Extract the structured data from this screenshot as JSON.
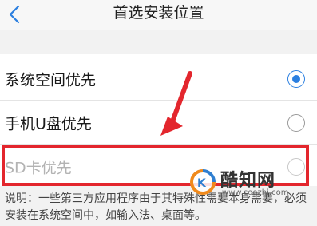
{
  "header": {
    "title": "首选安装位置",
    "back_icon": "chevron-left-icon"
  },
  "options": [
    {
      "label": "系统空间优先",
      "selected": true,
      "enabled": true
    },
    {
      "label": "手机U盘优先",
      "selected": false,
      "enabled": true
    },
    {
      "label": "SD卡优先",
      "selected": false,
      "enabled": false
    }
  ],
  "note": "说明：一些第三方应用程序由于其特殊性需要本身需要，必须安装在系统空间中，如输入法、桌面等。",
  "watermark": {
    "name": "酷知网",
    "url": "www.coozhi.com"
  },
  "colors": {
    "accent": "#2b7fe0",
    "annotation": "#e3262d"
  }
}
